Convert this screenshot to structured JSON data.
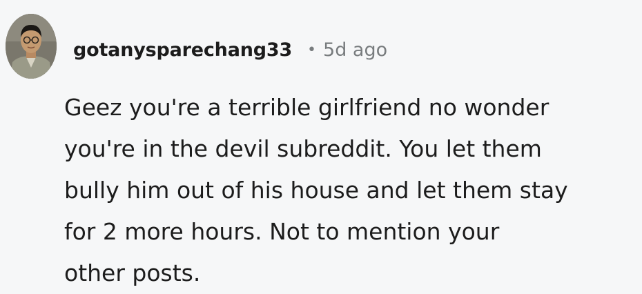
{
  "comment": {
    "username": "gotanysparechang33",
    "separator": "•",
    "timestamp": "5d ago",
    "avatar_icon": "user-avatar-photo",
    "body_lines": [
      "Geez you're a terrible girlfriend no wonder",
      "you're in the devil subreddit. You let them",
      "bully him out of his house and let them stay",
      "for 2 more hours. Not to mention your",
      "other posts."
    ]
  },
  "colors": {
    "background": "#f6f7f8",
    "text": "#1c1c1c",
    "muted": "#787c7e"
  }
}
